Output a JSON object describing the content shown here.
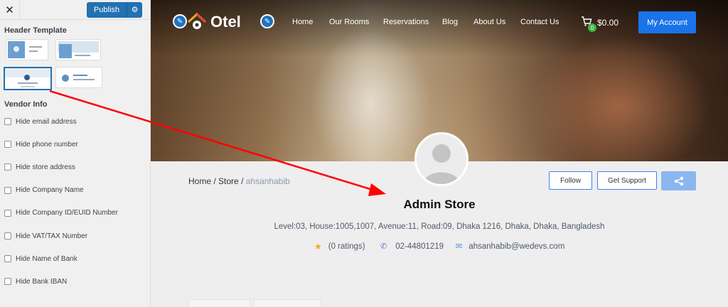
{
  "customizer": {
    "publish_label": "Publish",
    "header_template_title": "Header Template",
    "vendor_info_title": "Vendor Info",
    "options": [
      "Hide email address",
      "Hide phone number",
      "Hide store address",
      "Hide Company Name",
      "Hide Company ID/EUID Number",
      "Hide VAT/TAX Number",
      "Hide Name of Bank",
      "Hide Bank IBAN"
    ]
  },
  "site": {
    "logo_text": "Otel",
    "nav": [
      "Home",
      "Our Rooms",
      "Reservations",
      "Blog",
      "About Us",
      "Contact Us"
    ],
    "cart_count": "0",
    "cart_total": "$0.00",
    "account_label": "My Account"
  },
  "store": {
    "breadcrumb_home": "Home",
    "breadcrumb_store": "Store",
    "breadcrumb_current": "ahsanhabib",
    "follow_label": "Follow",
    "support_label": "Get Support",
    "name": "Admin Store",
    "address": "Level:03, House:1005,1007, Avenue:11, Road:09, Dhaka 1216, Dhaka, Dhaka, Bangladesh",
    "ratings": "(0 ratings)",
    "phone": "02-44801219",
    "email": "ahsanhabib@wedevs.com"
  },
  "colors": {
    "accent": "#1a73e8",
    "wp_blue": "#2271b1",
    "annotation_arrow": "#ff0000"
  }
}
